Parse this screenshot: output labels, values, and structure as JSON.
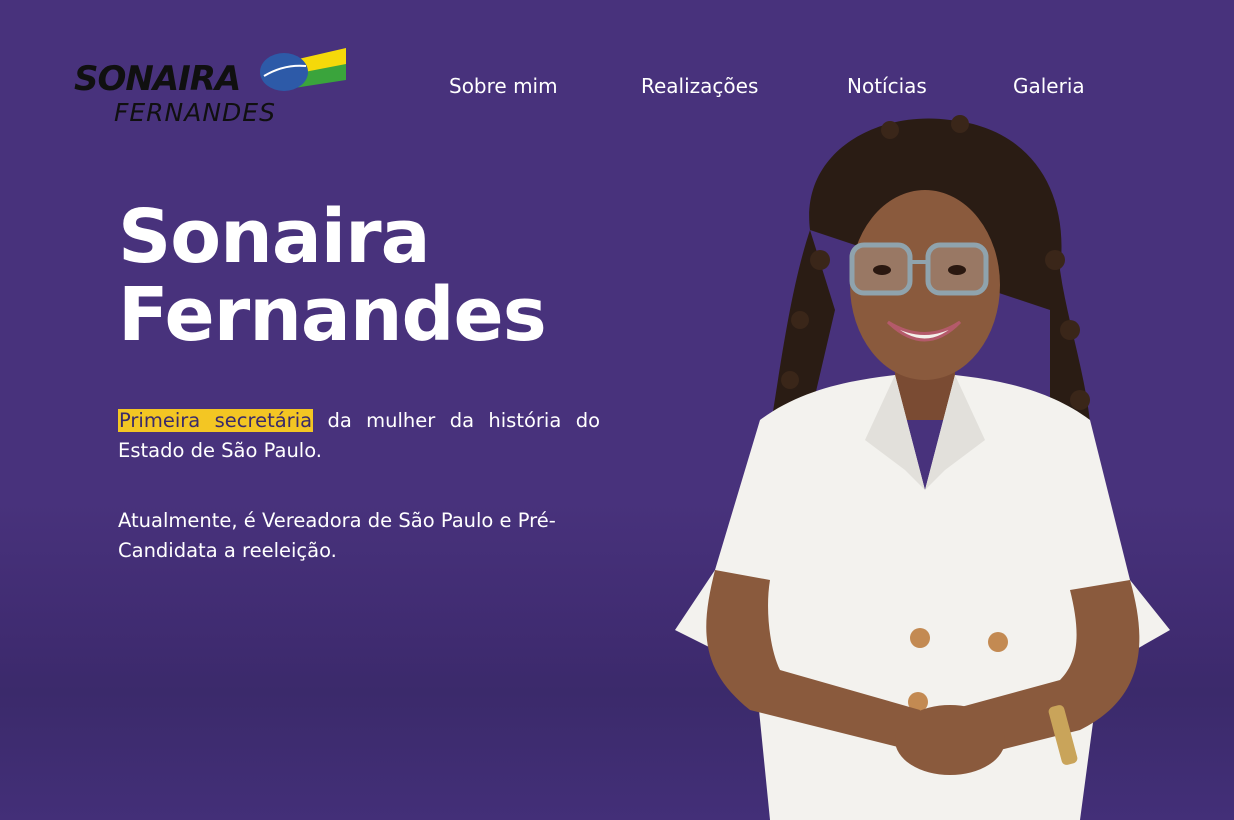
{
  "brand": {
    "line1": "SONAIRA",
    "line2": "FERNANDES"
  },
  "nav": {
    "items": [
      {
        "label": "Sobre mim"
      },
      {
        "label": "Realizações"
      },
      {
        "label": "Notícias"
      },
      {
        "label": "Galeria"
      }
    ]
  },
  "hero": {
    "title_line1": "Sonaira",
    "title_line2": "Fernandes",
    "intro_highlight": "Primeira secretária",
    "intro_rest": " da mulher da história do Estado de São Paulo.",
    "current": "Atualmente, é Vereadora de São Paulo e Pré-Candidata a reeleição."
  },
  "colors": {
    "background": "#48327c",
    "highlight": "#f3c623",
    "text": "#ffffff"
  },
  "icons": {
    "logo_flag": "brazil-flag-icon",
    "portrait": "woman-portrait-image"
  }
}
